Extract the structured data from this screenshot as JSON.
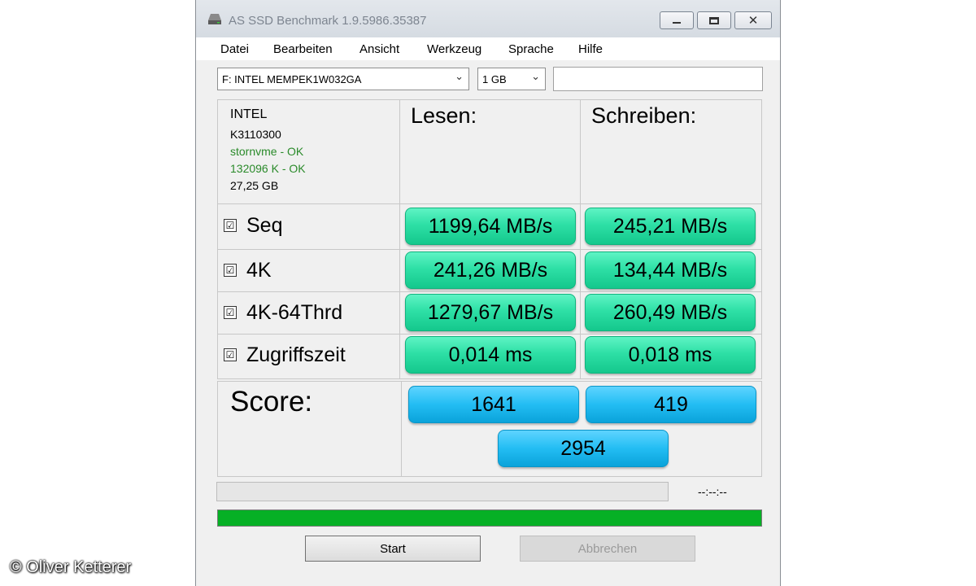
{
  "window": {
    "title": "AS SSD Benchmark 1.9.5986.35387",
    "controls": [
      "minimize",
      "maximize",
      "close"
    ]
  },
  "menu": [
    "Datei",
    "Bearbeiten",
    "Ansicht",
    "Werkzeug",
    "Sprache",
    "Hilfe"
  ],
  "toolbar": {
    "drive_select": "F: INTEL MEMPEK1W032GA",
    "size_select": "1 GB",
    "text_field": ""
  },
  "drive_info": {
    "vendor": "INTEL",
    "firmware": "K3110300",
    "driver": "stornvme - OK",
    "alignment": "132096 K - OK",
    "capacity": "27,25 GB"
  },
  "columns": {
    "read": "Lesen:",
    "write": "Schreiben:"
  },
  "tests": [
    {
      "label": "Seq",
      "checked": true,
      "read": "1199,64 MB/s",
      "write": "245,21 MB/s"
    },
    {
      "label": "4K",
      "checked": true,
      "read": "241,26 MB/s",
      "write": "134,44 MB/s"
    },
    {
      "label": "4K-64Thrd",
      "checked": true,
      "read": "1279,67 MB/s",
      "write": "260,49 MB/s"
    },
    {
      "label": "Zugriffszeit",
      "checked": true,
      "read": "0,014 ms",
      "write": "0,018 ms"
    }
  ],
  "score": {
    "label": "Score:",
    "read": "1641",
    "write": "419",
    "total": "2954"
  },
  "progress": {
    "test_progress": 0,
    "elapsed": "--:--:--",
    "overall_progress": 1.0
  },
  "buttons": {
    "start": "Start",
    "cancel": "Abbrechen"
  },
  "checkbox_glyph": "☑",
  "copyright": "© Oliver Ketterer",
  "colors": {
    "result_green": "#2ee0a6",
    "score_blue": "#23bdf3",
    "progress_green": "#06b025",
    "ok_text": "#2a8a2a"
  }
}
